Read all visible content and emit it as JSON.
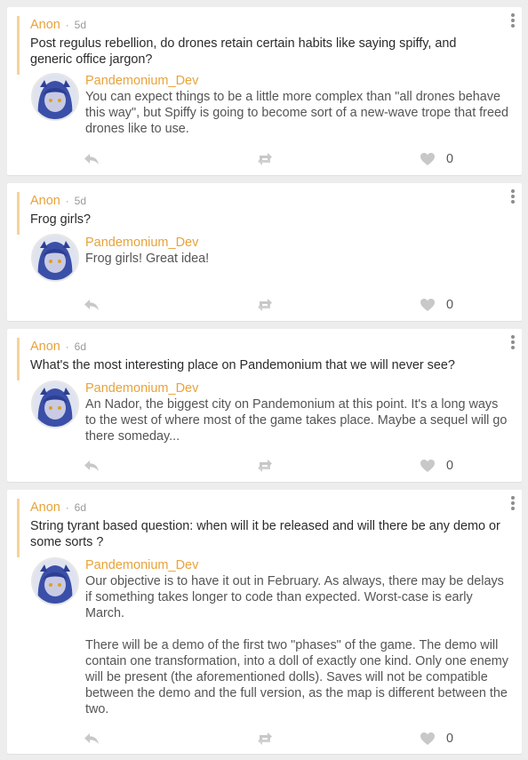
{
  "colors": {
    "accent": "#e8a33a",
    "quote_bar": "#f4d49b",
    "muted": "#9a9a9a",
    "icon": "#c8c8c8",
    "background": "#ededed"
  },
  "icons": {
    "menu": "vertical-dots-icon",
    "reply": "reply-arrow-icon",
    "repost": "repost-arrows-icon",
    "like": "heart-icon"
  },
  "posts": [
    {
      "asker": "Anon",
      "separator": "·",
      "age": "5d",
      "question": "Post regulus rebellion, do drones retain certain habits like saying spiffy, and generic office jargon?",
      "answerer": "Pandemonium_Dev",
      "answer": "You can expect things to be a little more complex than \"all drones behave this way\", but Spiffy is going to become sort of a new-wave trope that freed drones like to use.",
      "likes": "0"
    },
    {
      "asker": "Anon",
      "separator": "·",
      "age": "5d",
      "question": "Frog girls?",
      "answerer": "Pandemonium_Dev",
      "answer": "Frog girls! Great idea!",
      "likes": "0"
    },
    {
      "asker": "Anon",
      "separator": "·",
      "age": "6d",
      "question": "What's the most interesting place on Pandemonium that we will never see?",
      "answerer": "Pandemonium_Dev",
      "answer": "An Nador, the biggest city on Pandemonium at this point. It's a long ways to the west of where most of the game takes place. Maybe a sequel will go there someday...",
      "likes": "0"
    },
    {
      "asker": "Anon",
      "separator": "·",
      "age": "6d",
      "question": "String tyrant based question: when will it be released and will there be any demo or some sorts ?",
      "answerer": "Pandemonium_Dev",
      "answer": "Our objective is to have it out in February. As always, there may be delays if something takes longer to code than expected. Worst-case is early March.\n\nThere will be a demo of the first two \"phases\" of the game. The demo will contain one transformation, into a doll of exactly one kind. Only one enemy will be present (the aforementioned dolls). Saves will not be compatible between the demo and the full version, as the map is different between the two.",
      "likes": "0"
    }
  ]
}
